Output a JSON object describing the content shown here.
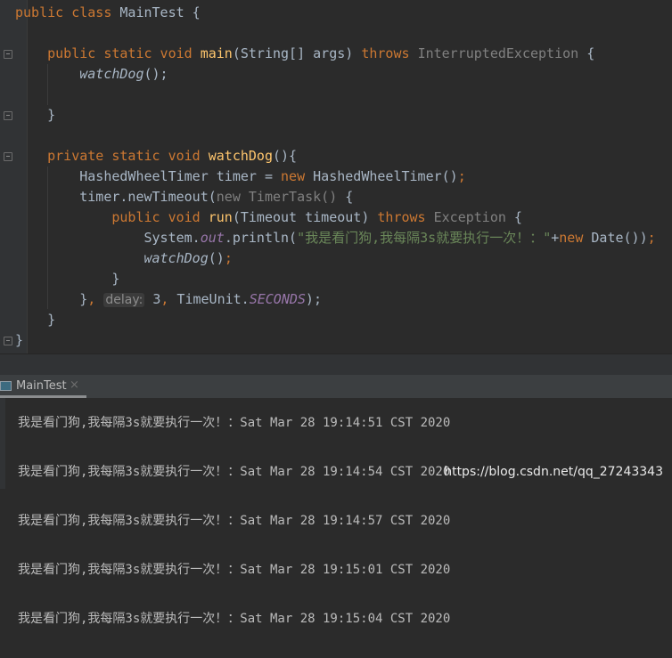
{
  "editor": {
    "lines": [
      [
        [
          "public class ",
          "kw"
        ],
        [
          "MainTest {",
          ""
        ]
      ],
      [],
      [
        [
          "    public static void ",
          "kw"
        ],
        [
          "main",
          "fn"
        ],
        [
          "(String[] args) ",
          ""
        ],
        [
          "throws ",
          "kw"
        ],
        [
          "InterruptedException",
          "gr"
        ],
        [
          " {",
          ""
        ]
      ],
      [
        [
          "        ",
          ""
        ],
        [
          "watchDog",
          "it"
        ],
        [
          "();",
          ""
        ]
      ],
      [],
      [
        [
          "    }",
          ""
        ]
      ],
      [],
      [
        [
          "    private static void ",
          "kw"
        ],
        [
          "watchDog",
          "fn"
        ],
        [
          "(){",
          ""
        ]
      ],
      [
        [
          "        HashedWheelTimer timer = ",
          ""
        ],
        [
          "new ",
          "kw"
        ],
        [
          "HashedWheelTimer()",
          ""
        ],
        [
          ";",
          "kw"
        ]
      ],
      [
        [
          "        timer.newTimeout(",
          ""
        ],
        [
          "new TimerTask()",
          "gr"
        ],
        [
          " {",
          ""
        ]
      ],
      [
        [
          "            ",
          ""
        ],
        [
          "public void ",
          "kw"
        ],
        [
          "run",
          "fn"
        ],
        [
          "(Timeout timeout) ",
          ""
        ],
        [
          "throws ",
          "kw"
        ],
        [
          "Exception",
          "gr"
        ],
        [
          " {",
          ""
        ]
      ],
      [
        [
          "                System.",
          ""
        ],
        [
          "out",
          "st"
        ],
        [
          ".println(",
          ""
        ],
        [
          "\"我是看门狗,我每隔3s就要执行一次！：\"",
          "str"
        ],
        [
          "+",
          ""
        ],
        [
          "new ",
          "kw"
        ],
        [
          "Date())",
          ""
        ],
        [
          ";",
          "kw"
        ]
      ],
      [
        [
          "                ",
          ""
        ],
        [
          "watchDog",
          "it"
        ],
        [
          "()",
          ""
        ],
        [
          ";",
          "kw"
        ]
      ],
      [
        [
          "            }",
          ""
        ]
      ],
      [
        [
          "        }",
          ""
        ],
        [
          ", ",
          "kw"
        ],
        [
          "delay:",
          "hint"
        ],
        [
          " 3",
          ""
        ],
        [
          ", ",
          "kw"
        ],
        [
          "TimeUnit.",
          ""
        ],
        [
          "SECONDS",
          "st"
        ],
        [
          ");",
          ""
        ]
      ],
      [
        [
          "    }",
          ""
        ]
      ],
      [
        [
          "}",
          ""
        ]
      ]
    ]
  },
  "run_panel": {
    "tab_label": "MainTest",
    "close_icon": "×",
    "console_lines": [
      "我是看门狗,我每隔3s就要执行一次！：Sat Mar 28 19:14:51 CST 2020",
      "我是看门狗,我每隔3s就要执行一次！：Sat Mar 28 19:14:54 CST 2020",
      "我是看门狗,我每隔3s就要执行一次！：Sat Mar 28 19:14:57 CST 2020",
      "我是看门狗,我每隔3s就要执行一次！：Sat Mar 28 19:15:01 CST 2020",
      "我是看门狗,我每隔3s就要执行一次！：Sat Mar 28 19:15:04 CST 2020"
    ]
  },
  "watermark": "https://blog.csdn.net/qq_27243343",
  "colors": {
    "keyword": "#cc7832",
    "text": "#a9b7c6",
    "method": "#ffc66d",
    "string": "#6a8759",
    "static_field": "#9876aa",
    "background": "#2b2b2b"
  }
}
